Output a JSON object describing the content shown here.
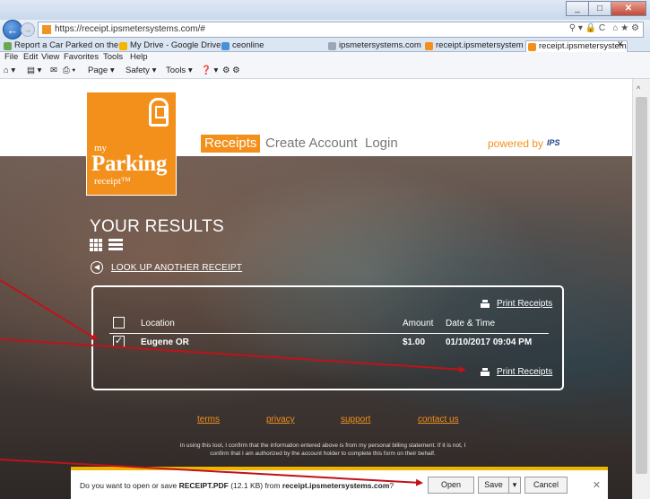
{
  "browser": {
    "url": "https://receipt.ipsmetersystems.com/#",
    "tabs": [
      {
        "label": "Report a Car Parked on the ...",
        "color": "#6aa84f"
      },
      {
        "label": "My Drive - Google Drive",
        "color": "#f4b400"
      },
      {
        "label": "ceonline",
        "color": "#4a90d9"
      },
      {
        "label": "ipsmetersystems.com",
        "color": "#9aa7b8"
      },
      {
        "label": "receipt.ipsmetersystems.co...",
        "color": "#f3901c"
      },
      {
        "label": "receipt.ipsmetersystems...",
        "color": "#f3901c"
      }
    ],
    "menu": [
      "File",
      "Edit",
      "View",
      "Favorites",
      "Tools",
      "Help"
    ],
    "commands": [
      "Page ▾",
      "Safety ▾",
      "Tools ▾"
    ]
  },
  "site": {
    "logo": {
      "my": "my",
      "parking": "Parking",
      "receipt": "receipt™"
    },
    "nav": {
      "receipts": "Receipts",
      "create_account": "Create Account",
      "login": "Login"
    },
    "powered_by": "powered by",
    "powered_logo": "IPS"
  },
  "results": {
    "title": "YOUR RESULTS",
    "back_link": "LOOK UP ANOTHER RECEIPT",
    "print_label": "Print Receipts",
    "columns": {
      "location": "Location",
      "amount": "Amount",
      "datetime": "Date & Time"
    },
    "rows": [
      {
        "location": "Eugene OR",
        "amount": "$1.00",
        "datetime": "01/10/2017 09:04 PM",
        "checked": true
      }
    ]
  },
  "footer": {
    "links": {
      "terms": "terms",
      "privacy": "privacy",
      "support": "support",
      "contact": "contact us"
    },
    "disclaimer": "In using this tool, I confirm that the information entered above is from my personal billing statement. If it is not, I confirm that I am authorized by the account holder to complete this form on their behalf."
  },
  "download_bar": {
    "prefix": "Do you want to open or save ",
    "filename": "RECEIPT.PDF",
    "size": " (12.1 KB) from ",
    "host": "receipt.ipsmetersystems.com",
    "suffix": "?",
    "open": "Open",
    "save": "Save",
    "cancel": "Cancel"
  },
  "colors": {
    "brand": "#f3901c",
    "arrow": "#c0121a"
  }
}
